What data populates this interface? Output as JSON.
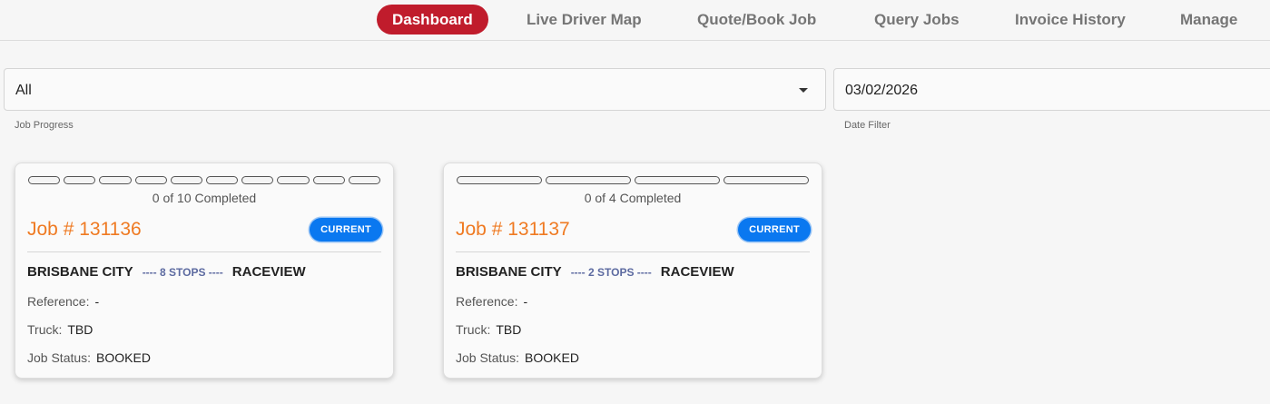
{
  "nav": {
    "dashboard": "Dashboard",
    "live_driver_map": "Live Driver Map",
    "quote_book_job": "Quote/Book Job",
    "query_jobs": "Query Jobs",
    "invoice_history": "Invoice History",
    "manage": "Manage"
  },
  "filters": {
    "job_progress": {
      "value": "All",
      "helper": "Job Progress"
    },
    "date": {
      "value": "03/02/2026",
      "helper": "Date Filter"
    }
  },
  "colors": {
    "accent": "#c01c2c",
    "job_number": "#ef7a22",
    "badge": "#0a78f0"
  },
  "jobs": [
    {
      "progress_total": 10,
      "progress_done": 0,
      "completed_text": "0 of 10 Completed",
      "job_number": "Job # 131136",
      "badge": "CURRENT",
      "origin": "BRISBANE CITY",
      "stops_text": "---- 8 STOPS ----",
      "destination": "RACEVIEW",
      "reference_label": "Reference:",
      "reference_value": "-",
      "truck_label": "Truck:",
      "truck_value": "TBD",
      "status_label": "Job Status:",
      "status_value": "BOOKED"
    },
    {
      "progress_total": 4,
      "progress_done": 0,
      "completed_text": "0 of 4 Completed",
      "job_number": "Job # 131137",
      "badge": "CURRENT",
      "origin": "BRISBANE CITY",
      "stops_text": "---- 2 STOPS ----",
      "destination": "RACEVIEW",
      "reference_label": "Reference:",
      "reference_value": "-",
      "truck_label": "Truck:",
      "truck_value": "TBD",
      "status_label": "Job Status:",
      "status_value": "BOOKED"
    }
  ]
}
